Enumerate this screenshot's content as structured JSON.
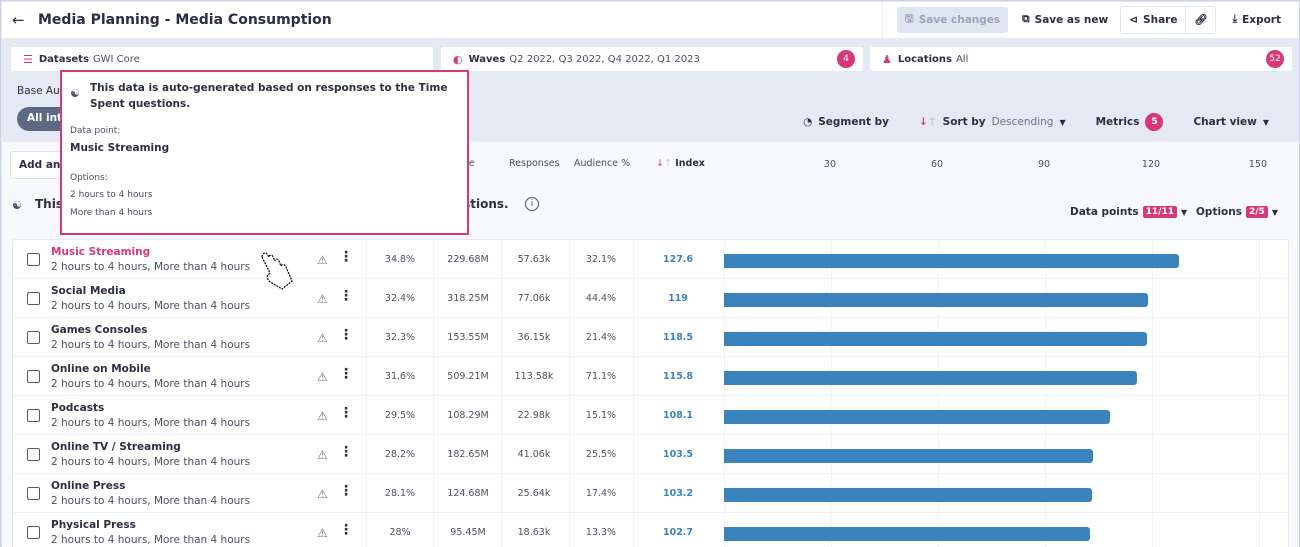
{
  "header": {
    "back_icon": "arrow-left-icon",
    "title": "Media Planning - Media Consumption",
    "actions": {
      "save_changes": "Save changes",
      "save_as_new": "Save as new",
      "share": "Share",
      "export": "Export"
    }
  },
  "filters": {
    "datasets": {
      "label": "Datasets",
      "value": "GWI Core"
    },
    "waves": {
      "label": "Waves",
      "value": "Q2 2022, Q3 2022, Q4 2022, Q1 2023",
      "count": "4"
    },
    "locations": {
      "label": "Locations",
      "value": "All",
      "count": "52"
    }
  },
  "base_audience": {
    "label": "Base Au",
    "pill": "All int"
  },
  "toolbar": {
    "segment_by": "Segment by",
    "sort_by_label": "Sort by",
    "sort_by_value": "Descending",
    "metrics_label": "Metrics",
    "metrics_count": "5",
    "chart_view": "Chart view"
  },
  "table_controls": {
    "add_input": "Add an",
    "notice_start": "This",
    "notice_end": "estions.",
    "data_points_label": "Data points",
    "data_points_value": "11/11",
    "options_label": "Options",
    "options_value": "2/5"
  },
  "columns": {
    "universe": "erse",
    "responses": "Responses",
    "audience_pct": "Audience %",
    "index": "Index"
  },
  "tooltip": {
    "heading": "This data is auto-generated based on responses to the Time Spent questions.",
    "data_point_label": "Data point:",
    "data_point_value": "Music Streaming",
    "options_label": "Options:",
    "options": [
      "2 hours to 4 hours",
      "More than 4 hours"
    ]
  },
  "chart_data": {
    "type": "bar",
    "orientation": "horizontal",
    "xlabel": "Index",
    "xlim": [
      0,
      150
    ],
    "x_ticks": [
      "30",
      "60",
      "90",
      "120",
      "150"
    ],
    "grid": true,
    "categories": [
      "Music Streaming",
      "Social Media",
      "Games Consoles",
      "Online on Mobile",
      "Podcasts",
      "Online TV / Streaming",
      "Online Press",
      "Physical Press"
    ],
    "values": [
      127.6,
      119,
      118.5,
      115.8,
      108.1,
      103.5,
      103.2,
      102.7
    ],
    "bar_color": "#3b83bd"
  },
  "rows": [
    {
      "name": "Music Streaming",
      "options": "2 hours to 4 hours, More than 4 hours",
      "col1": "34.8%",
      "universe": "229.68M",
      "responses": "57.63k",
      "audience_pct": "32.1%",
      "index": "127.6",
      "active": true
    },
    {
      "name": "Social Media",
      "options": "2 hours to 4 hours, More than 4 hours",
      "col1": "32.4%",
      "universe": "318.25M",
      "responses": "77.06k",
      "audience_pct": "44.4%",
      "index": "119"
    },
    {
      "name": "Games Consoles",
      "options": "2 hours to 4 hours, More than 4 hours",
      "col1": "32.3%",
      "universe": "153.55M",
      "responses": "36.15k",
      "audience_pct": "21.4%",
      "index": "118.5"
    },
    {
      "name": "Online on Mobile",
      "options": "2 hours to 4 hours, More than 4 hours",
      "col1": "31.6%",
      "universe": "509.21M",
      "responses": "113.58k",
      "audience_pct": "71.1%",
      "index": "115.8"
    },
    {
      "name": "Podcasts",
      "options": "2 hours to 4 hours, More than 4 hours",
      "col1": "29.5%",
      "universe": "108.29M",
      "responses": "22.98k",
      "audience_pct": "15.1%",
      "index": "108.1"
    },
    {
      "name": "Online TV / Streaming",
      "options": "2 hours to 4 hours, More than 4 hours",
      "col1": "28.2%",
      "universe": "182.65M",
      "responses": "41.06k",
      "audience_pct": "25.5%",
      "index": "103.5"
    },
    {
      "name": "Online Press",
      "options": "2 hours to 4 hours, More than 4 hours",
      "col1": "28.1%",
      "universe": "124.68M",
      "responses": "25.64k",
      "audience_pct": "17.4%",
      "index": "103.2"
    },
    {
      "name": "Physical Press",
      "options": "2 hours to 4 hours, More than 4 hours",
      "col1": "28%",
      "universe": "95.45M",
      "responses": "18.63k",
      "audience_pct": "13.3%",
      "index": "102.7"
    }
  ],
  "colors": {
    "accent": "#d6387a",
    "bar": "#3b83bd",
    "index_text": "#3b83bd"
  }
}
